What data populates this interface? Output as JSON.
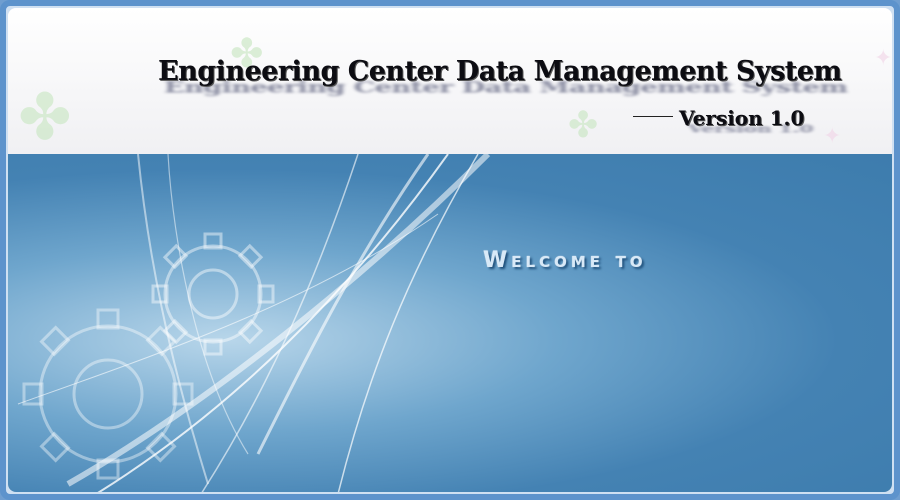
{
  "header": {
    "title": "Engineering Center Data Management System",
    "version": "Version 1.0",
    "decorations": [
      "maple-leaf-icon",
      "star-icon"
    ]
  },
  "banner": {
    "welcome_text": "Welcome to",
    "decorations": [
      "gear-icon",
      "light-streaks"
    ]
  },
  "colors": {
    "frame": "#5d93cc",
    "banner_base": "#4482b3",
    "header_bg": "#f3f3f6",
    "title_text": "#0c0c12"
  }
}
